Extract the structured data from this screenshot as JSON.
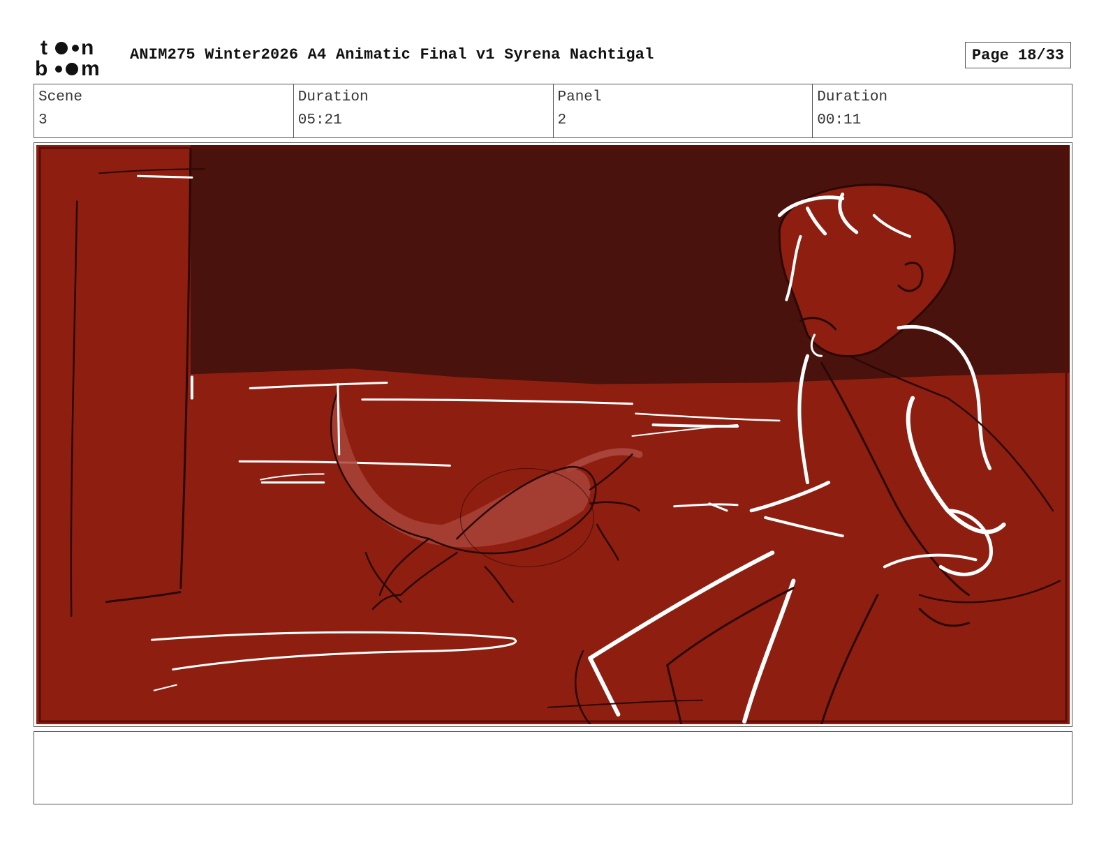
{
  "header": {
    "logo_text": "toonboom",
    "title": "ANIM275 Winter2026 A4 Animatic Final v1 Syrena Nachtigal",
    "page_label": "Page 18/33"
  },
  "info": {
    "scene_label": "Scene",
    "scene_value": "3",
    "scene_duration_label": "Duration",
    "scene_duration_value": "05:21",
    "panel_label": "Panel",
    "panel_value": "2",
    "panel_duration_label": "Duration",
    "panel_duration_value": "00:11"
  },
  "panel": {
    "colors": {
      "sky": "#4a120c",
      "ground": "#8e1f10",
      "frame_border": "#5a0d08",
      "sketch_dark": "#2a0806",
      "sketch_light": "#ffffff",
      "creature_fill": "#a8443a"
    }
  },
  "notes": {
    "text": ""
  }
}
